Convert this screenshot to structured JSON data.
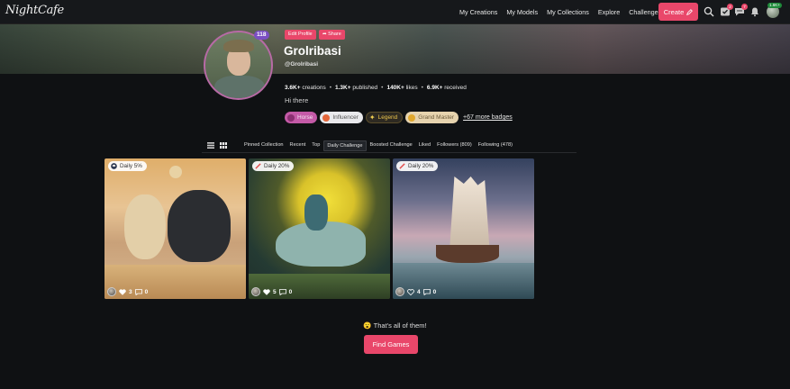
{
  "app": {
    "logo": "NightCafe"
  },
  "nav": {
    "links": [
      "My Creations",
      "My Models",
      "My Collections",
      "Explore",
      "Challenges"
    ],
    "create_label": "Create",
    "badges": {
      "tasks": "2",
      "messages": "7"
    },
    "avatar_badge": "1.6K+"
  },
  "profile": {
    "level": "118",
    "edit_label": "Edit Profile",
    "share_label": "Share",
    "name": "Grolribasi",
    "handle": "@Grolribasi",
    "stats": [
      {
        "value": "3.6K+",
        "label": "creations"
      },
      {
        "value": "1.3K+",
        "label": "published"
      },
      {
        "value": "140K+",
        "label": "likes"
      },
      {
        "value": "6.9K+",
        "label": "received"
      }
    ],
    "bio": "Hi there",
    "badges": [
      {
        "label": "Horse",
        "icon": "horse-icon"
      },
      {
        "label": "Influencer",
        "icon": "influencer-icon"
      },
      {
        "label": "Legend",
        "icon": "sparkle-icon"
      },
      {
        "label": "Grand Master",
        "icon": "heart-hands-icon"
      }
    ],
    "more_badges": "+67 more badges"
  },
  "tabs": [
    "Pinned Collection",
    "Recent",
    "Top",
    "Daily Challenge",
    "Boosted Challenge",
    "Liked",
    "Followers (809)",
    "Following (478)"
  ],
  "active_tab": "Daily Challenge",
  "cards": [
    {
      "chip": "Daily 5%",
      "chip_icon": "trophy-icon",
      "likes": "3",
      "comments": "0"
    },
    {
      "chip": "Daily 20%",
      "chip_icon": "brush-icon",
      "likes": "5",
      "comments": "0"
    },
    {
      "chip": "Daily 20%",
      "chip_icon": "brush-icon",
      "likes": "4",
      "comments": "0"
    }
  ],
  "footer": {
    "message": "That's all of them!",
    "button": "Find Games"
  },
  "colors": {
    "accent": "#e9476a",
    "background": "#0f1113"
  }
}
